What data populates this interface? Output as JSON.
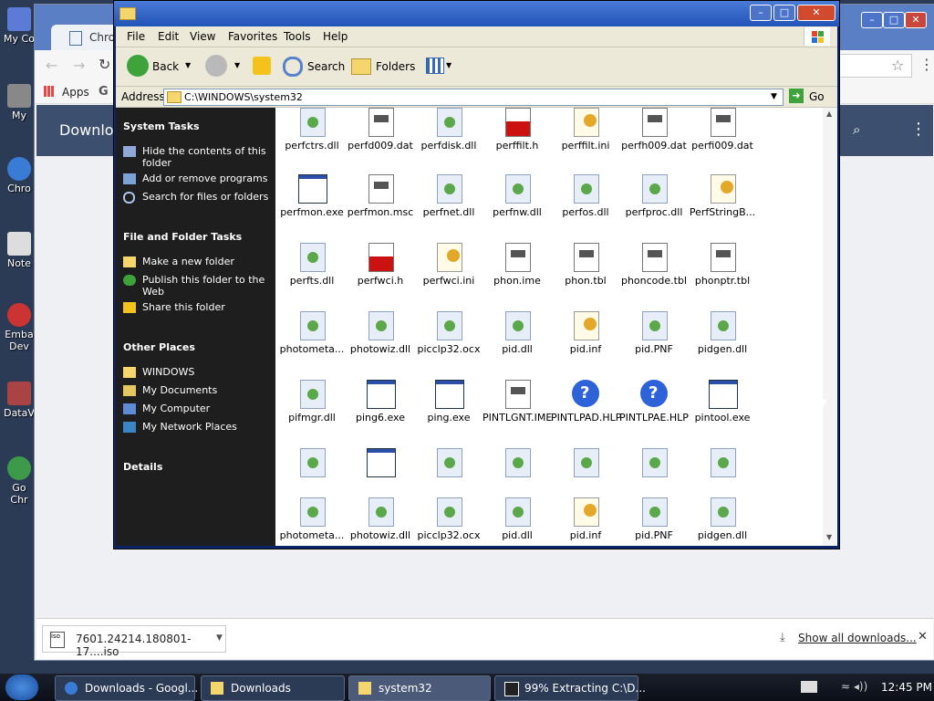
{
  "desktop": {
    "icons": [
      "My Co",
      "My",
      "Chro",
      "Note",
      "Emba",
      "Dev",
      "DataV",
      "Go",
      "Chr"
    ]
  },
  "chrome": {
    "tab_title": "Chrome",
    "bookmarks_apps": "Apps",
    "downloads_title": "Downloads",
    "download_item": "7601.24214.180801-17....iso",
    "show_all": "Show all downloads...",
    "close_shelf": "✕",
    "menu_dots": "⋮",
    "search_glyph": "🔍"
  },
  "explorer": {
    "menu": [
      "File",
      "Edit",
      "View",
      "Favorites",
      "Tools",
      "Help"
    ],
    "toolbar": {
      "back": "Back",
      "search": "Search",
      "folders": "Folders"
    },
    "address_label": "Address",
    "address": "C:\\WINDOWS\\system32",
    "go": "Go",
    "system_tasks": {
      "title": "System Tasks",
      "items": [
        "Hide the contents of this folder",
        "Add or remove programs",
        "Search for files or folders"
      ]
    },
    "file_tasks": {
      "title": "File and Folder Tasks",
      "items": [
        "Make a new folder",
        "Publish this folder to the Web",
        "Share this folder"
      ]
    },
    "other_places": {
      "title": "Other Places",
      "items": [
        "WINDOWS",
        "My Documents",
        "My Computer",
        "My Network Places"
      ]
    },
    "details": {
      "title": "Details"
    },
    "files": [
      {
        "name": "perfctrs.dll",
        "type": "dll"
      },
      {
        "name": "perfd009.dat",
        "type": "dat"
      },
      {
        "name": "perfdisk.dll",
        "type": "dll"
      },
      {
        "name": "perffilt.h",
        "type": "h"
      },
      {
        "name": "perffilt.ini",
        "type": "ini"
      },
      {
        "name": "perfh009.dat",
        "type": "dat"
      },
      {
        "name": "perfi009.dat",
        "type": "dat"
      },
      {
        "name": "perfmon.exe",
        "type": "exe"
      },
      {
        "name": "perfmon.msc",
        "type": "dat"
      },
      {
        "name": "perfnet.dll",
        "type": "dll"
      },
      {
        "name": "perfnw.dll",
        "type": "dll"
      },
      {
        "name": "perfos.dll",
        "type": "dll"
      },
      {
        "name": "perfproc.dll",
        "type": "dll"
      },
      {
        "name": "PerfStringB...",
        "type": "ini"
      },
      {
        "name": "perfts.dll",
        "type": "dll"
      },
      {
        "name": "perfwci.h",
        "type": "h"
      },
      {
        "name": "perfwci.ini",
        "type": "ini"
      },
      {
        "name": "phon.ime",
        "type": "dat"
      },
      {
        "name": "phon.tbl",
        "type": "dat"
      },
      {
        "name": "phoncode.tbl",
        "type": "dat"
      },
      {
        "name": "phonptr.tbl",
        "type": "dat"
      },
      {
        "name": "photometa...",
        "type": "dll"
      },
      {
        "name": "photowiz.dll",
        "type": "dll"
      },
      {
        "name": "picclp32.ocx",
        "type": "dll"
      },
      {
        "name": "pid.dll",
        "type": "dll"
      },
      {
        "name": "pid.inf",
        "type": "ini"
      },
      {
        "name": "pid.PNF",
        "type": "dll"
      },
      {
        "name": "pidgen.dll",
        "type": "dll"
      },
      {
        "name": "pifmgr.dll",
        "type": "dll"
      },
      {
        "name": "ping6.exe",
        "type": "exe"
      },
      {
        "name": "ping.exe",
        "type": "exe"
      },
      {
        "name": "PINTLGNT.IME",
        "type": "dat"
      },
      {
        "name": "PINTLPAD.HLP",
        "type": "hlp"
      },
      {
        "name": "PINTLPAE.HLP",
        "type": "hlp"
      },
      {
        "name": "pintool.exe",
        "type": "exe"
      },
      {
        "name": "",
        "type": "dll"
      },
      {
        "name": "",
        "type": "exe"
      },
      {
        "name": "",
        "type": "dll"
      },
      {
        "name": "",
        "type": "dll"
      },
      {
        "name": "",
        "type": "dll"
      },
      {
        "name": "",
        "type": "dll"
      },
      {
        "name": "",
        "type": "dll"
      },
      {
        "name": "photometa...",
        "type": "dll"
      },
      {
        "name": "photowiz.dll",
        "type": "dll"
      },
      {
        "name": "picclp32.ocx",
        "type": "dll"
      },
      {
        "name": "pid.dll",
        "type": "dll"
      },
      {
        "name": "pid.inf",
        "type": "ini"
      },
      {
        "name": "pid.PNF",
        "type": "dll"
      },
      {
        "name": "pidgen.dll",
        "type": "dll"
      }
    ]
  },
  "taskbar": {
    "items": [
      "Downloads - Googl...",
      "Downloads",
      "system32",
      "99% Extracting C:\\D..."
    ],
    "clock": "12:45 PM"
  },
  "colors": {
    "xp_blue": "#2153b8",
    "pane_dark": "#1e1e1e",
    "hlp_blue": "#2d62d8",
    "h_red": "#cc1111"
  }
}
